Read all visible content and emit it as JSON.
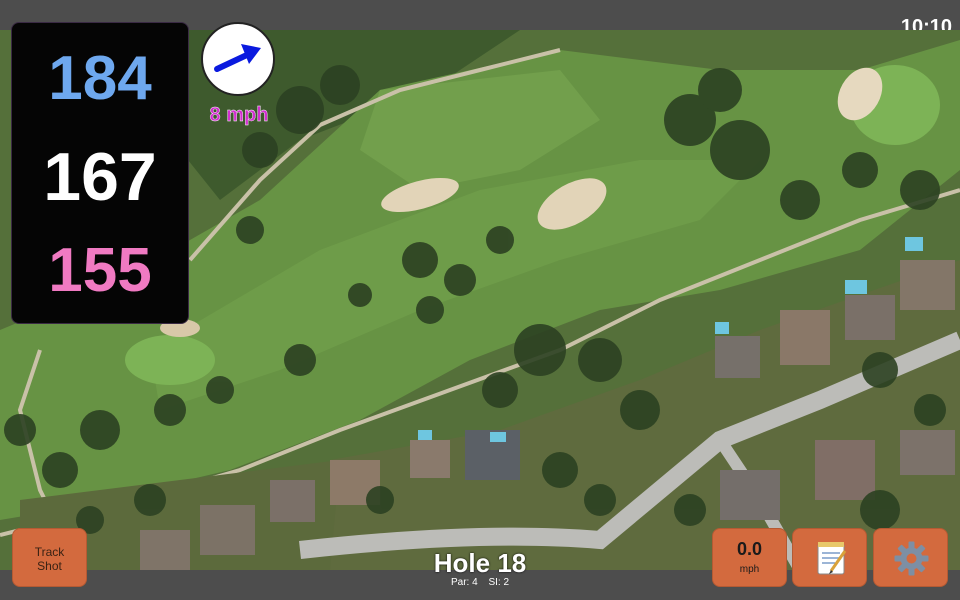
{
  "status_bar": {
    "time": "10:10"
  },
  "distances": {
    "back": {
      "value": "184",
      "color": "#6ea8ef"
    },
    "middle": {
      "value": "167",
      "color": "#ffffff"
    },
    "front": {
      "value": "155",
      "color": "#f07ac2"
    }
  },
  "wind": {
    "speed_label": "8 mph",
    "arrow_icon": "wind-arrow-icon",
    "arrow_color": "#0a1adf"
  },
  "buttons": {
    "track_shot": {
      "line1": "Track",
      "line2": "Shot"
    },
    "wind_speed": {
      "value": "0.0",
      "unit": "mph"
    },
    "notes": {
      "icon": "notepad-icon"
    },
    "settings": {
      "icon": "gear-icon"
    }
  },
  "hole": {
    "title": "Hole 18",
    "par": "Par: 4",
    "si": "SI: 2"
  },
  "colors": {
    "button": "#d36a3e",
    "fairway": "#5f8a3e",
    "bar": "#4d4d4d"
  }
}
